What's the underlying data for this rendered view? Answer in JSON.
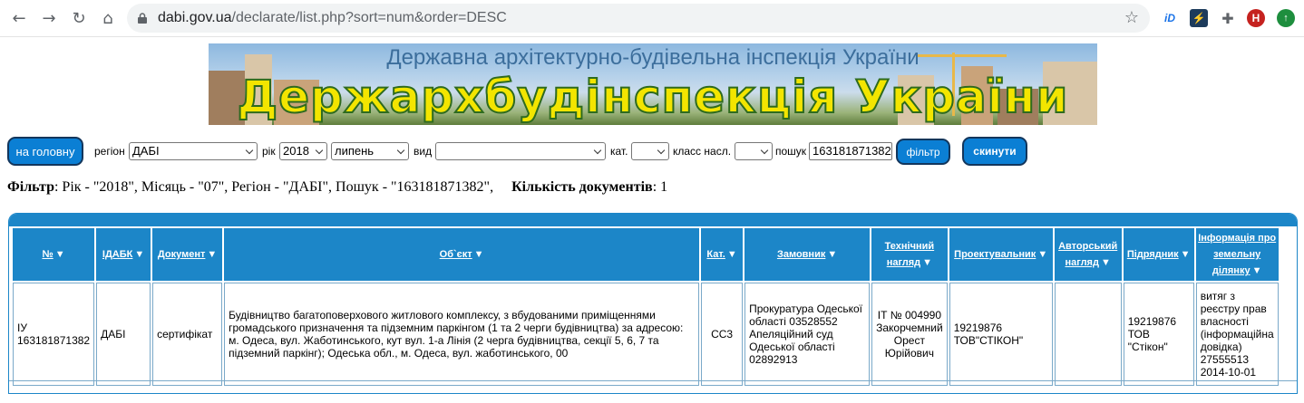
{
  "browser": {
    "url_host": "dabi.gov.ua",
    "url_path": "/declarate/list.php?sort=num&order=DESC",
    "profile_initial": "H"
  },
  "banner": {
    "subtitle": "Державна архітектурно-будівельна інспекція України",
    "title": "Держархбудінспекція України"
  },
  "filters": {
    "home_label": "на головну",
    "region_label": "регіон",
    "region_value": "ДАБІ",
    "year_label": "рік",
    "year_value": "2018",
    "month_value": "липень",
    "type_label": "вид",
    "type_value": "",
    "cat_label": "кат.",
    "cat_value": "",
    "class_label": "класс насл.",
    "class_value": "",
    "search_label": "пошук",
    "search_value": "163181871382",
    "filter_button": "фільтр",
    "reset_button": "скинути"
  },
  "summary": {
    "filter_label": "Фільтр",
    "filter_text": ": Рік - \"2018\", Місяць - \"07\", Регіон - \"ДАБІ\", Пошук - \"163181871382\",",
    "count_label": "Кількість документів",
    "count_value": ": 1"
  },
  "table": {
    "columns": [
      "№",
      "ІДАБК",
      "Документ",
      "Об`єкт",
      "Кат.",
      "Замовник",
      "Технічний нагляд",
      "Проектувальник",
      "Авторський нагляд",
      "Підрядник",
      "Інформація про земельну ділянку"
    ],
    "row": {
      "num": "ІУ 163181871382",
      "idabk": "ДАБІ",
      "doc": "сертифікат",
      "object": "Будівництво багатоповерхового житлового комплексу, з вбудованими приміщеннями громадського призначення та підземним паркінгом (1 та 2 черги будівництва) за адресою: м. Одеса, вул. Жаботинського, кут вул. 1-а Лінія (2 черга будівництва, секції 5, 6, 7 та підземний паркінг); Одеська обл., м. Одеса, вул. жаботинського, 00",
      "cat": "СС3",
      "customer": "Прокуратура Одеської області 03528552 Апеляційний суд Одеської області 02892913",
      "tech": "ІТ № 004990 Закорчемний Орест Юрійович",
      "designer": "19219876 ТОВ\"СТІКОН\"",
      "author": "",
      "contractor": "19219876 ТОВ \"Стікон\"",
      "land": "витяг з реєстру прав власності (інформаційна довідка) 27555513 2014-10-01"
    }
  }
}
